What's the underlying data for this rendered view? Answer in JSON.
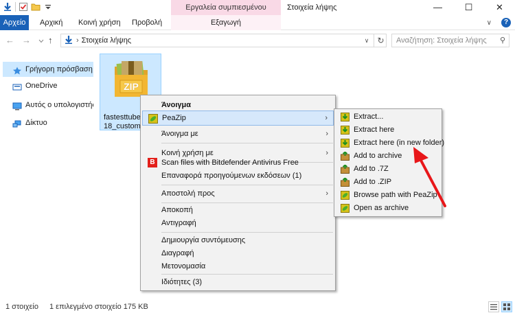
{
  "window": {
    "title": "Στοιχεία λήψης",
    "contextual_tab_title": "Εργαλεία συμπιεσμένου φακέλου",
    "minimize": "—",
    "maximize": "☐",
    "close": "✕"
  },
  "ribbon": {
    "tabs": [
      "Αρχείο",
      "Αρχική",
      "Κοινή χρήση",
      "Προβολή"
    ],
    "contextual_tab": "Εξαγωγή",
    "expand": "∨",
    "help": "?"
  },
  "address": {
    "back": "←",
    "forward": "→",
    "up": "↑",
    "separator": "›",
    "path": "Στοιχεία λήψης",
    "dropdown": "∨",
    "refresh": "↻",
    "search_placeholder": "Αναζήτηση: Στοιχεία λήψης",
    "search_icon": "⚲"
  },
  "nav_pane": {
    "items": [
      {
        "label": "Γρήγορη πρόσβαση",
        "icon": "star-icon"
      },
      {
        "label": "OneDrive",
        "icon": "cloud-icon"
      },
      {
        "label": "Αυτός ο υπολογιστής",
        "icon": "computer-icon"
      },
      {
        "label": "Δίκτυο",
        "icon": "network-icon"
      }
    ]
  },
  "file": {
    "name_line1": "fastesttube_",
    "name_line2": "18_custom_",
    "icon_label": "ZIP"
  },
  "context_menu": {
    "items": [
      {
        "label": "Άνοιγμα",
        "bold": true
      },
      {
        "label": "PeaZip",
        "submenu": true,
        "icon": "peazip-icon"
      },
      {
        "label": "Άνοιγμα με",
        "submenu": true
      },
      {
        "label": "Κοινή χρήση με",
        "submenu": true
      },
      {
        "label": "Scan files with Bitdefender Antivirus Free",
        "icon": "bitdefender-icon"
      },
      {
        "label": "Επαναφορά προηγούμενων εκδόσεων (1)"
      },
      {
        "label": "Αποστολή προς",
        "submenu": true
      },
      {
        "label": "Αποκοπή"
      },
      {
        "label": "Αντιγραφή"
      },
      {
        "label": "Δημιουργία συντόμευσης"
      },
      {
        "label": "Διαγραφή"
      },
      {
        "label": "Μετονομασία"
      },
      {
        "label": "Ιδιότητες (3)"
      }
    ],
    "submenu_arrow": "›",
    "bitdefender_glyph": "B"
  },
  "peazip_submenu": {
    "items": [
      {
        "label": "Extract...",
        "icon": "extract-icon"
      },
      {
        "label": "Extract here",
        "icon": "extract-icon"
      },
      {
        "label": "Extract here (in new folder)",
        "icon": "extract-icon"
      },
      {
        "label": "Add to archive",
        "icon": "add-archive-icon"
      },
      {
        "label": "Add to .7Z",
        "icon": "add-archive-icon"
      },
      {
        "label": "Add to .ZIP",
        "icon": "add-archive-icon"
      },
      {
        "label": "Browse path with PeaZip",
        "icon": "peazip-icon"
      },
      {
        "label": "Open as archive",
        "icon": "peazip-icon"
      }
    ]
  },
  "status": {
    "count": "1 στοιχείο",
    "selected": "1 επιλεγμένο στοιχείο  175 KB"
  },
  "colors": {
    "accent": "#1a62b8",
    "selection": "#cce8ff",
    "contextual_tab": "#f9d9e6",
    "annotation_arrow": "#e8171a"
  }
}
